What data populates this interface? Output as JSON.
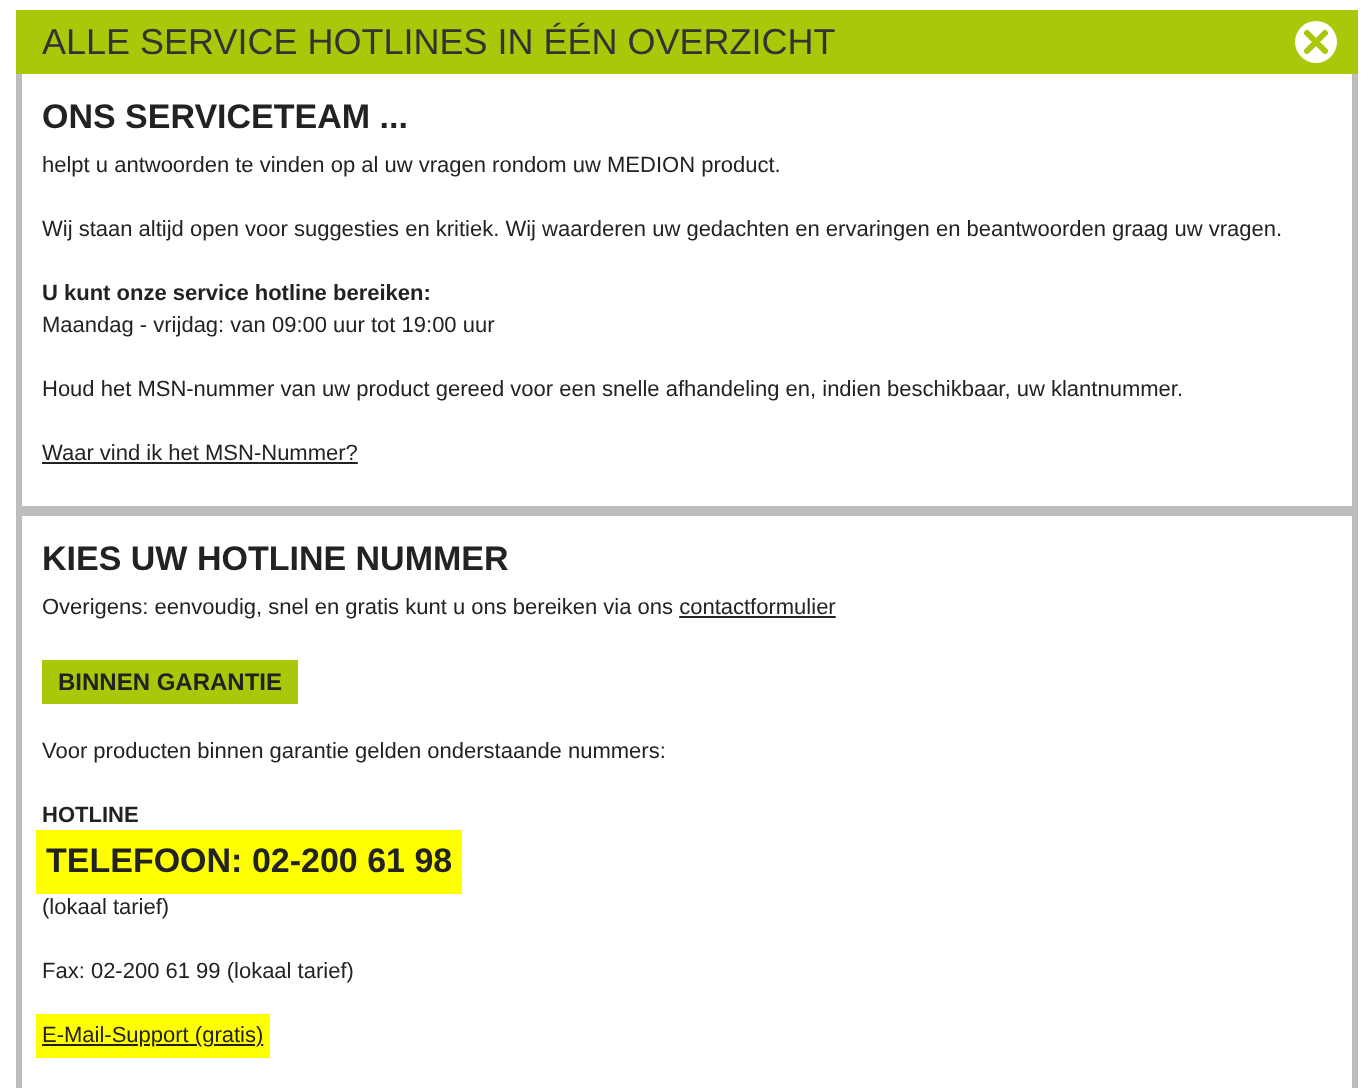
{
  "title": "ALLE SERVICE HOTLINES IN ÉÉN OVERZICHT",
  "sections": [
    {
      "heading": "ONS SERVICETEAM ...",
      "blocks": [
        {
          "kind": "text",
          "text": "helpt u antwoorden te vinden op al uw vragen rondom uw MEDION product."
        },
        {
          "kind": "text",
          "text": "Wij staan altijd open voor suggesties en kritiek. Wij waarderen uw gedachten en ervaringen en beantwoorden graag uw vragen."
        },
        {
          "kind": "pair",
          "label": "U kunt onze service hotline bereiken:",
          "text": "Maandag - vrijdag: van 09:00 uur tot 19:00 uur"
        },
        {
          "kind": "text",
          "text": "Houd het MSN-nummer van uw product gereed voor een snelle afhandeling en, indien beschikbaar, uw klantnummer."
        },
        {
          "kind": "link",
          "text": "Waar vind ik het MSN-Nummer?",
          "highlighted": false
        }
      ]
    },
    {
      "heading": "KIES UW HOTLINE NUMMER",
      "blocks": [
        {
          "kind": "textlink",
          "text": "Overigens: eenvoudig, snel en gratis kunt u ons bereiken via ons",
          "link": "contactformulier"
        },
        {
          "kind": "tag",
          "text": "BINNEN GARANTIE"
        },
        {
          "kind": "text",
          "text": "Voor producten binnen garantie gelden onderstaande nummers:"
        },
        {
          "kind": "phone",
          "label": "HOTLINE",
          "number": "TELEFOON: 02-200 61 98",
          "note": "(lokaal tarief)",
          "highlighted": true
        },
        {
          "kind": "text",
          "text": "Fax: 02-200 61 99 (lokaal tarief)"
        },
        {
          "kind": "link",
          "text": "E-Mail-Support (gratis)",
          "highlighted": true
        }
      ]
    }
  ]
}
